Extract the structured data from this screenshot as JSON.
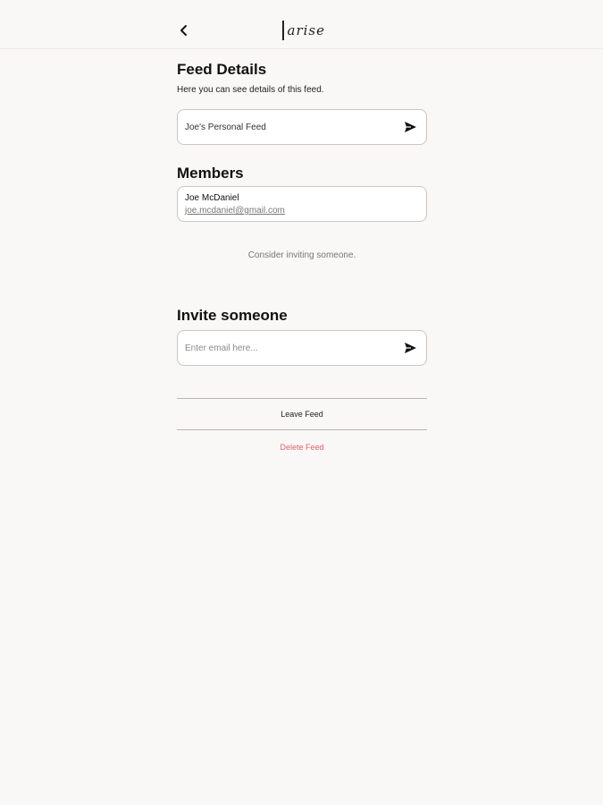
{
  "header": {
    "back_icon": "chevron-left-icon",
    "logo_text": "arise"
  },
  "feed_details": {
    "title": "Feed Details",
    "subtitle": "Here you can see details of this feed.",
    "feed_name": "Joe's Personal Feed",
    "send_icon": "send-icon"
  },
  "members": {
    "title": "Members",
    "items": [
      {
        "name": "Joe McDaniel",
        "email": "joe.mcdaniel@gmail.com"
      }
    ],
    "hint": "Consider inviting someone."
  },
  "invite": {
    "title": "Invite someone",
    "placeholder": "Enter email here...",
    "send_icon": "send-icon"
  },
  "actions": {
    "leave_label": "Leave Feed",
    "delete_label": "Delete Feed"
  },
  "colors": {
    "background": "#faf8f6",
    "danger": "#e8606a",
    "border": "#c9c6c3"
  }
}
